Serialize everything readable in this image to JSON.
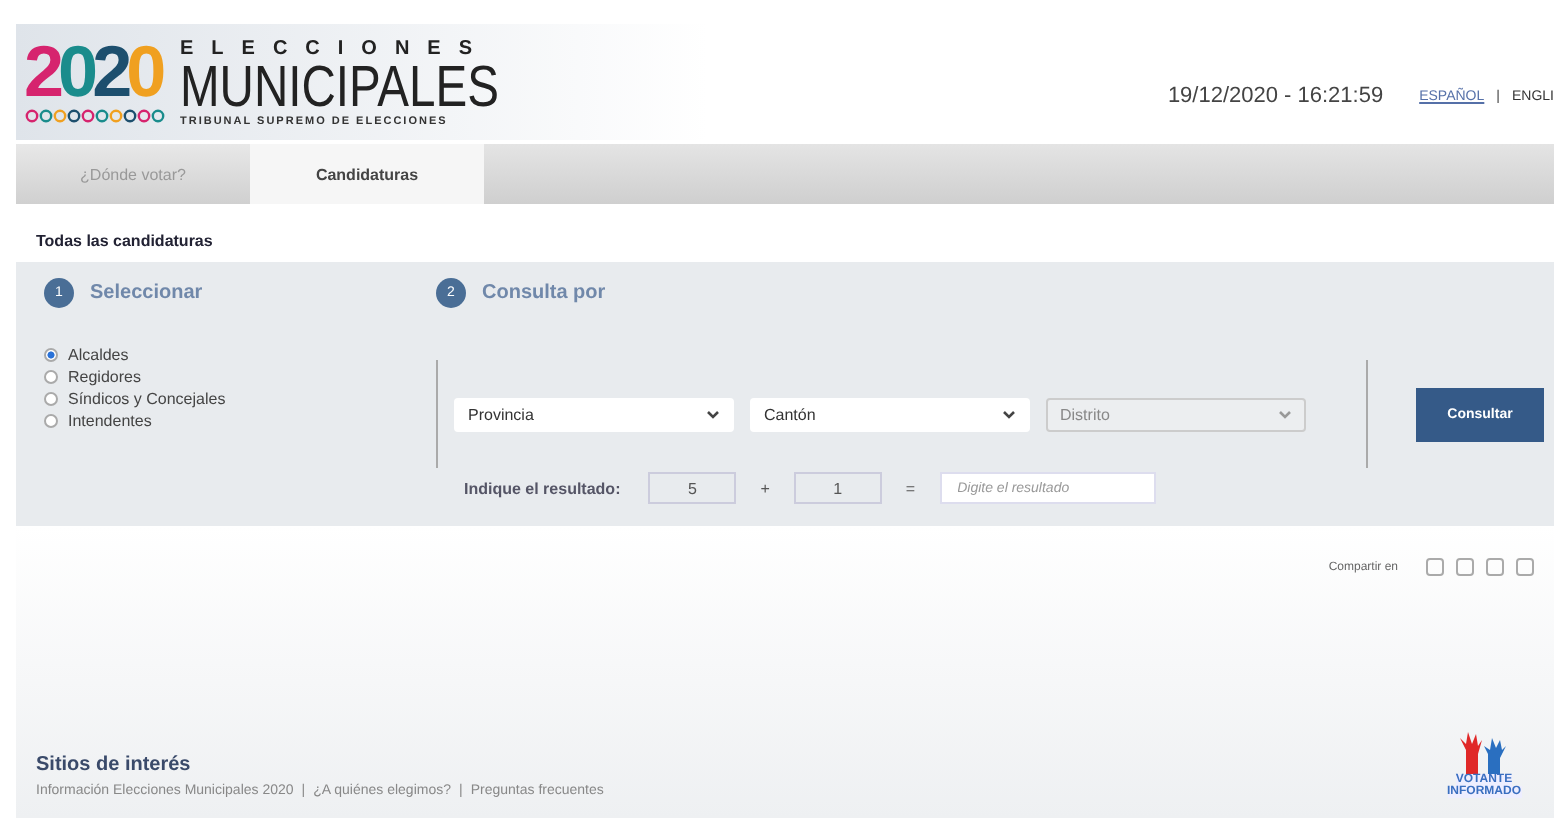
{
  "header": {
    "logo": {
      "year_digits": [
        {
          "text": "2",
          "color": "#d6246e"
        },
        {
          "text": "0",
          "color": "#1a8c8c"
        },
        {
          "text": "2",
          "color": "#1d4f6e"
        },
        {
          "text": "0",
          "color": "#f0a020"
        }
      ],
      "overline": "ELECCIONES",
      "title": "MUNICIPALES",
      "subtitle": "TRIBUNAL SUPREMO DE ELECCIONES"
    },
    "datetime": "19/12/2020 - 16:21:59",
    "language_separator": "|",
    "languages": [
      {
        "label": "ESPAÑOL",
        "selected": true
      },
      {
        "label": "ENGLI",
        "selected": false
      }
    ]
  },
  "tabs": [
    {
      "label": "¿Dónde votar?",
      "selected": false
    },
    {
      "label": "Candidaturas",
      "selected": true
    }
  ],
  "section_title": "Todas las candidaturas",
  "steps": [
    {
      "number": "1",
      "title": "Seleccionar"
    },
    {
      "number": "2",
      "title": "Consulta por"
    }
  ],
  "options": [
    {
      "label": "Alcaldes",
      "selected": true
    },
    {
      "label": "Regidores",
      "selected": false
    },
    {
      "label": "Síndicos y Concejales",
      "selected": false
    },
    {
      "label": "Intendentes",
      "selected": false
    }
  ],
  "selects": [
    {
      "value": "Provincia",
      "disabled": false
    },
    {
      "value": "Cantón",
      "disabled": false
    },
    {
      "value": "Distrito",
      "disabled": true
    }
  ],
  "captcha": {
    "label": "Indique el resultado:",
    "a": "5",
    "op": "+",
    "b": "1",
    "eq": "=",
    "placeholder": "Digite el resultado"
  },
  "submit": "Consultar",
  "share_label": "Compartir en",
  "footer": {
    "title": "Sitios de interés",
    "link_separator": "|",
    "links": [
      "Información Elecciones Municipales 2020",
      "¿A quiénes elegimos?",
      "Preguntas frecuentes"
    ],
    "badge": {
      "line1": "VOTANTE",
      "line2": "INFORMADO"
    }
  }
}
